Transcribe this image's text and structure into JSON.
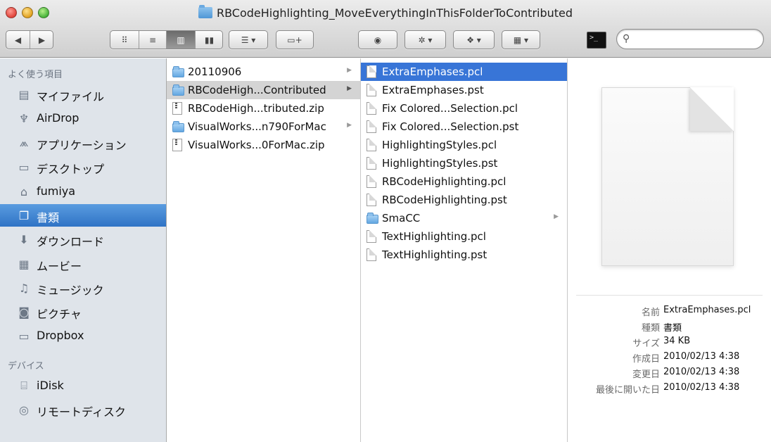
{
  "window": {
    "title": "RBCodeHighlighting_MoveEverythingInThisFolderToContributed"
  },
  "toolbar": {
    "back_icon": "back-arrow-icon",
    "forward_icon": "forward-arrow-icon",
    "view_modes": [
      "icon-view",
      "list-view",
      "column-view",
      "coverflow-view"
    ],
    "active_view": "column-view",
    "search": {
      "placeholder": "",
      "value": ""
    }
  },
  "sidebar": {
    "favorites_header": "よく使う項目",
    "favorites": [
      {
        "label": "マイファイル",
        "icon": "all-my-files-icon"
      },
      {
        "label": "AirDrop",
        "icon": "airdrop-icon"
      },
      {
        "label": "アプリケーション",
        "icon": "applications-icon"
      },
      {
        "label": "デスクトップ",
        "icon": "desktop-icon"
      },
      {
        "label": "fumiya",
        "icon": "home-icon"
      },
      {
        "label": "書類",
        "icon": "documents-icon",
        "selected": true
      },
      {
        "label": "ダウンロード",
        "icon": "downloads-icon"
      },
      {
        "label": "ムービー",
        "icon": "movies-icon"
      },
      {
        "label": "ミュージック",
        "icon": "music-icon"
      },
      {
        "label": "ピクチャ",
        "icon": "pictures-icon"
      },
      {
        "label": "Dropbox",
        "icon": "folder-icon"
      }
    ],
    "devices_header": "デバイス",
    "devices": [
      {
        "label": "iDisk",
        "icon": "idisk-icon"
      },
      {
        "label": "リモートディスク",
        "icon": "remote-disc-icon"
      }
    ]
  },
  "column1": [
    {
      "label": "20110906",
      "kind": "folder",
      "has_children": true
    },
    {
      "label": "RBCodeHigh...Contributed",
      "kind": "folder",
      "has_children": true,
      "selected_inactive": true
    },
    {
      "label": "RBCodeHigh...tributed.zip",
      "kind": "zip"
    },
    {
      "label": "VisualWorks...n790ForMac",
      "kind": "folder",
      "has_children": true
    },
    {
      "label": "VisualWorks...0ForMac.zip",
      "kind": "zip"
    }
  ],
  "column2": [
    {
      "label": "ExtraEmphases.pcl",
      "kind": "doc",
      "selected": true
    },
    {
      "label": "ExtraEmphases.pst",
      "kind": "doc"
    },
    {
      "label": "Fix Colored...Selection.pcl",
      "kind": "doc"
    },
    {
      "label": "Fix Colored...Selection.pst",
      "kind": "doc"
    },
    {
      "label": "HighlightingStyles.pcl",
      "kind": "doc"
    },
    {
      "label": "HighlightingStyles.pst",
      "kind": "doc"
    },
    {
      "label": "RBCodeHighlighting.pcl",
      "kind": "doc"
    },
    {
      "label": "RBCodeHighlighting.pst",
      "kind": "doc"
    },
    {
      "label": "SmaCC",
      "kind": "folder",
      "has_children": true
    },
    {
      "label": "TextHighlighting.pcl",
      "kind": "doc"
    },
    {
      "label": "TextHighlighting.pst",
      "kind": "doc"
    }
  ],
  "preview": {
    "info": [
      {
        "key": "名前",
        "value": "ExtraEmphases.pcl"
      },
      {
        "key": "種類",
        "value": "書類"
      },
      {
        "key": "サイズ",
        "value": "34 KB"
      },
      {
        "key": "作成日",
        "value": "2010/02/13 4:38"
      },
      {
        "key": "変更日",
        "value": "2010/02/13 4:38"
      },
      {
        "key": "最後に開いた日",
        "value": "2010/02/13 4:38"
      }
    ]
  },
  "colors": {
    "selection": "#3875d7",
    "sidebar_bg": "#dfe4ea",
    "sidebar_selection": "#2f73c5"
  }
}
